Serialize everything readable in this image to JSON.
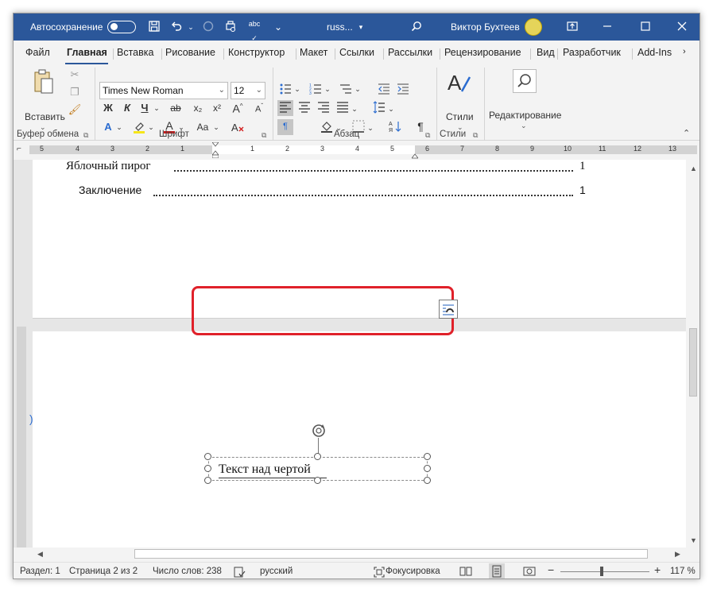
{
  "titlebar": {
    "autosave_label": "Автосохранение",
    "filename": "russ...",
    "user_name": "Виктор Бухтеев"
  },
  "tabs": [
    "Файл",
    "Главная",
    "Вставка",
    "Рисование",
    "Конструктор",
    "Макет",
    "Ссылки",
    "Рассылки",
    "Рецензирование",
    "Вид",
    "Разработчик",
    "Add-Ins"
  ],
  "ribbon": {
    "clipboard": {
      "paste_label": "Вставить",
      "group_label": "Буфер обмена"
    },
    "font": {
      "font_name": "Times New Roman",
      "font_size": "12",
      "group_label": "Шрифт",
      "bold": "Ж",
      "italic": "К",
      "underline": "Ч",
      "font_color_letter": "A",
      "highlight_letter": "A",
      "aa": "Aa",
      "a_letter": "A"
    },
    "paragraph": {
      "group_label": "Абзац"
    },
    "styles": {
      "label": "Стили",
      "group_label": "Стили"
    },
    "editing": {
      "label": "Редактирование"
    }
  },
  "ruler": {
    "numbers": [
      "5",
      "4",
      "3",
      "2",
      "1",
      "1",
      "2",
      "3",
      "4",
      "5",
      "6",
      "7",
      "8",
      "9",
      "10",
      "11",
      "12",
      "13"
    ]
  },
  "document": {
    "toc_line1_text": "Яблочный пирог",
    "toc_line1_page": "1",
    "toc_line2_text": "Заключение",
    "toc_line2_page": "1",
    "textbox_text": "Текст над чертой"
  },
  "statusbar": {
    "section": "Раздел: 1",
    "page": "Страница 2 из 2",
    "words": "Число слов: 238",
    "language": "русский",
    "focus": "Фокусировка",
    "zoom": "117 %"
  }
}
